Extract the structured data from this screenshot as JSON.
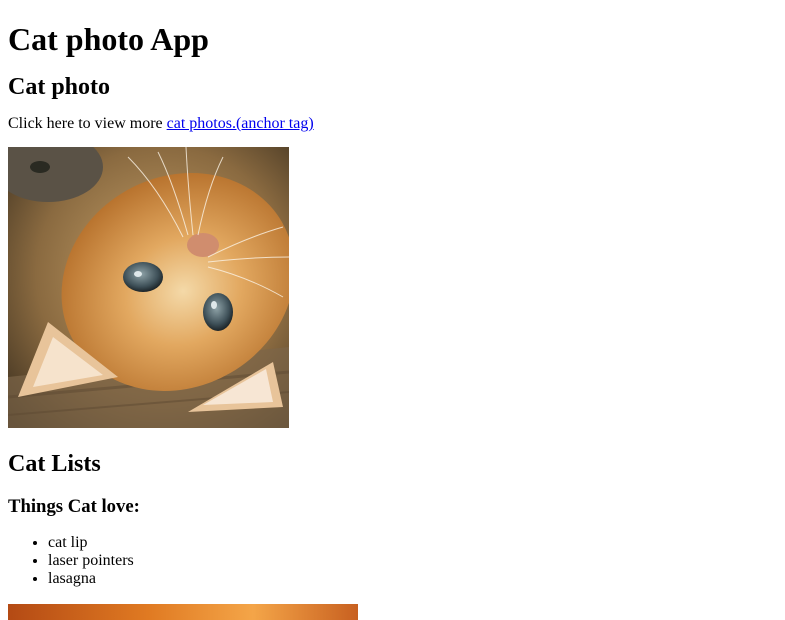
{
  "page": {
    "title": "Cat photo App"
  },
  "photo_section": {
    "heading": "Cat photo",
    "intro_text": "Click here to view more ",
    "link_text": "cat photos.(anchor tag)"
  },
  "lists_section": {
    "heading": "Cat Lists",
    "subheading": "Things Cat love:",
    "items": [
      "cat lip",
      "laser pointers",
      "lasagna"
    ]
  },
  "colors": {
    "link": "#0000ee",
    "text": "#000000",
    "background": "#ffffff"
  },
  "images": {
    "main": "kitten-lying-upside-down",
    "second": "orange-photo-cropped"
  }
}
